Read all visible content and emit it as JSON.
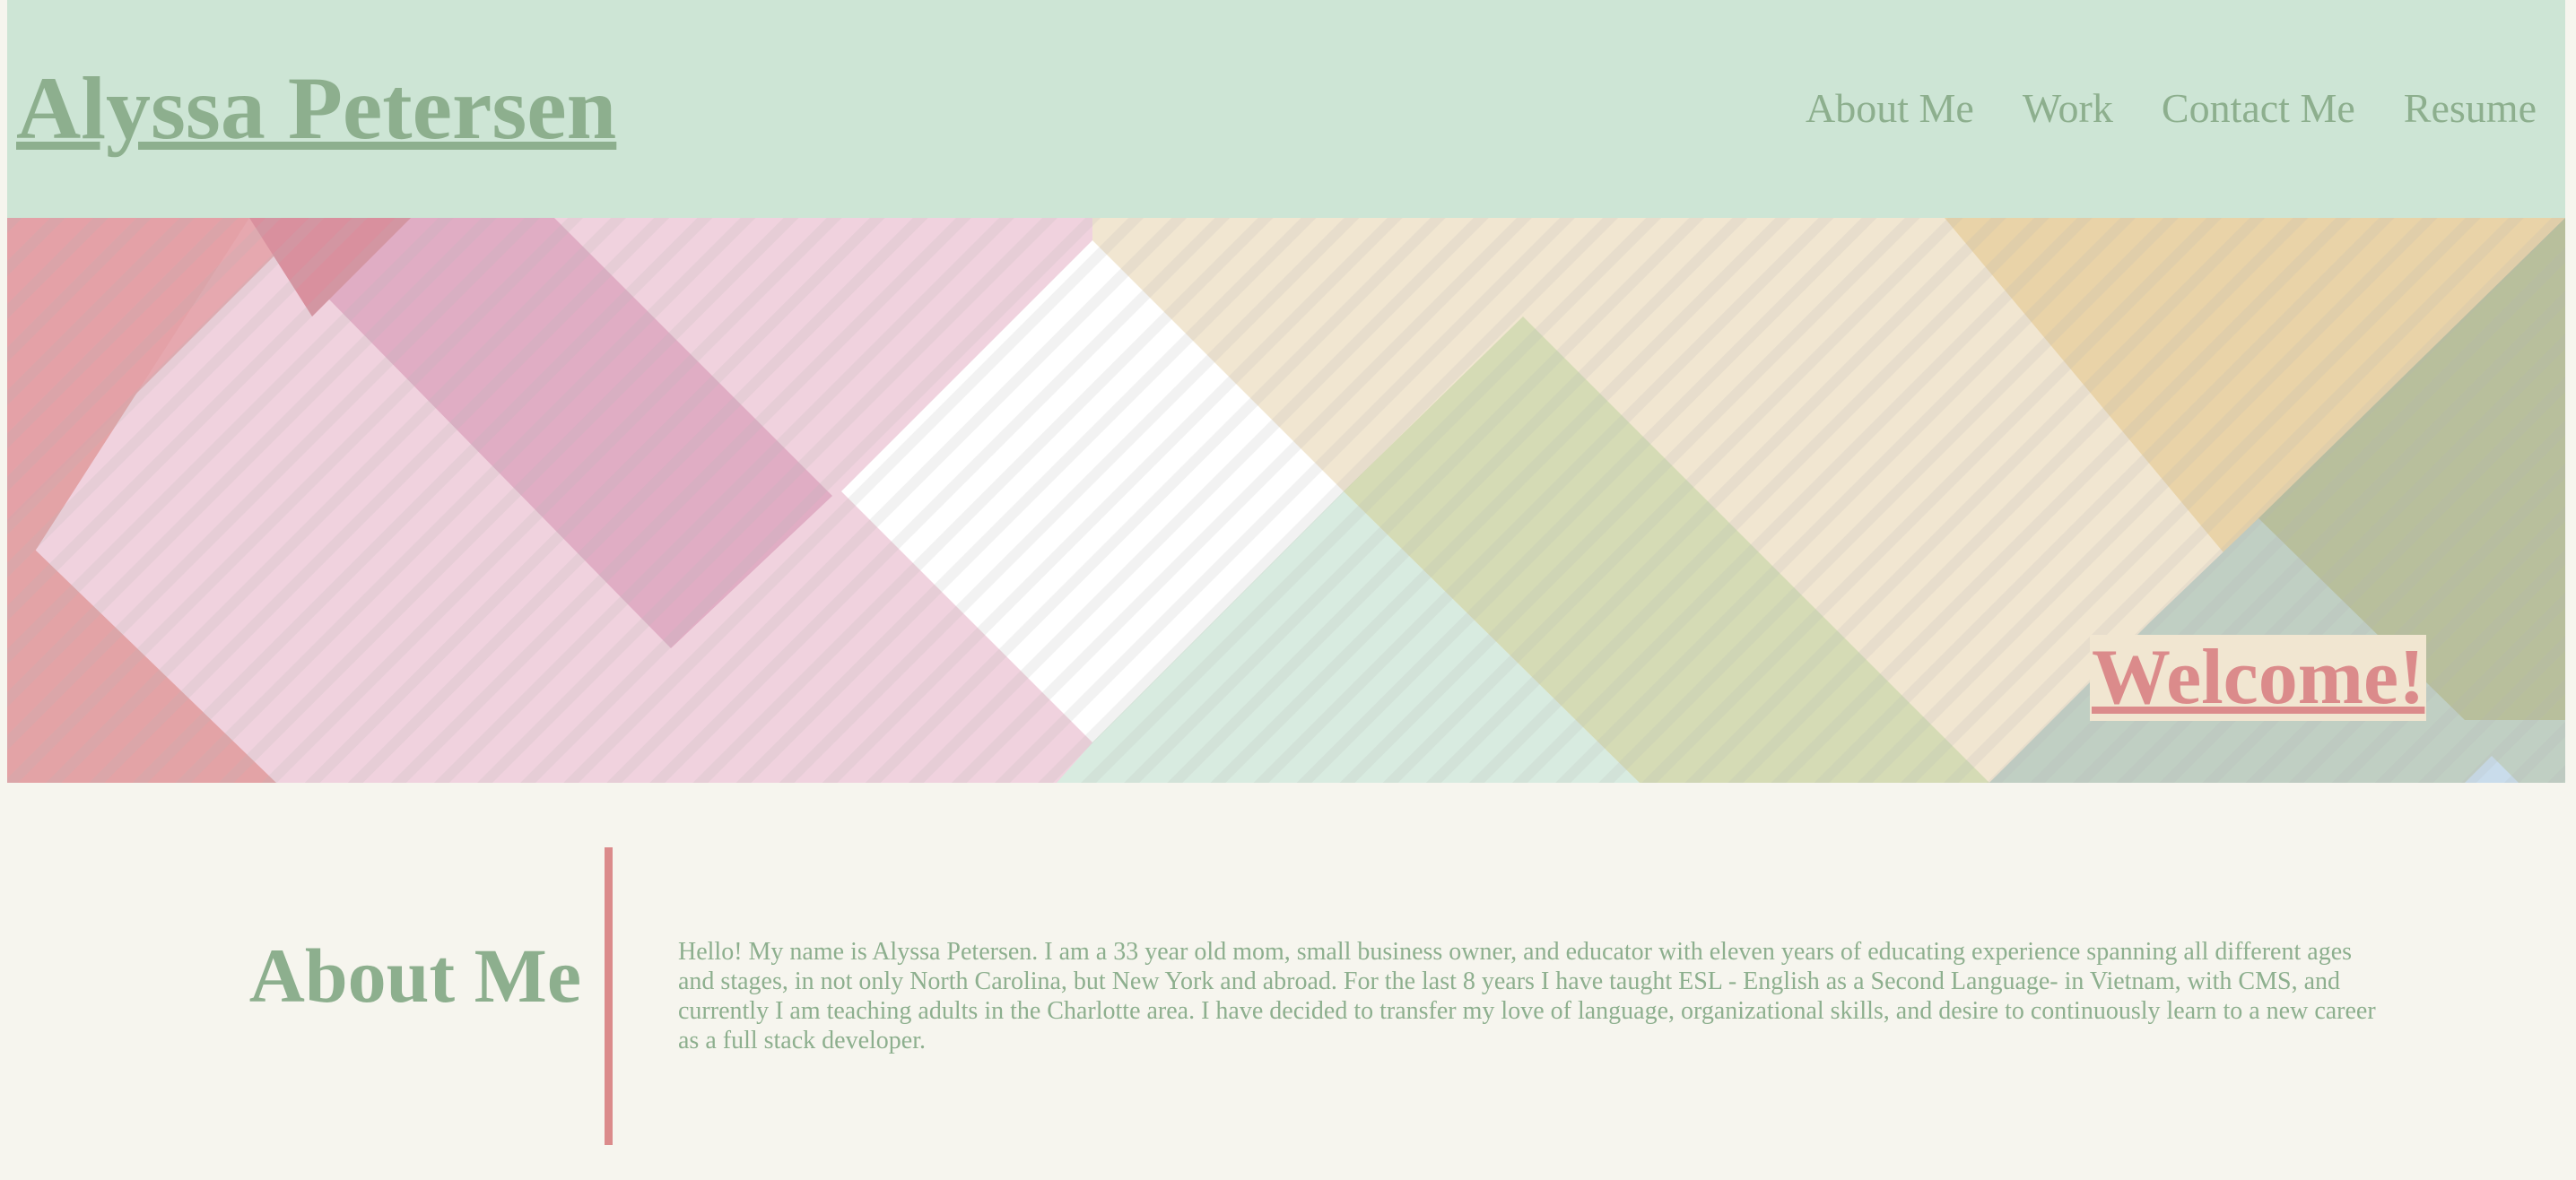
{
  "header": {
    "title": "Alyssa Petersen",
    "nav": [
      "About Me",
      "Work",
      "Contact Me",
      "Resume"
    ]
  },
  "banner": {
    "welcome": "Welcome!"
  },
  "about": {
    "heading": "About Me",
    "text": "Hello! My name is Alyssa Petersen. I am a 33 year old mom, small business owner, and educator with eleven years of educating experience spanning all different ages and stages, in not only North Carolina, but New York and abroad. For the last 8 years I have taught ESL - English as a Second Language- in Vietnam, with CMS, and currently I am teaching adults in the Charlotte area. I have decided to transfer my love of language, organizational skills, and desire to continuously learn to a new career as a full stack developer."
  },
  "colors": {
    "header_bg": "#cde5d5",
    "page_bg": "#f6f5ee",
    "accent_green": "#8daf8e",
    "accent_pink": "#db8b8b",
    "banner_cream": "#f1e6d1"
  }
}
